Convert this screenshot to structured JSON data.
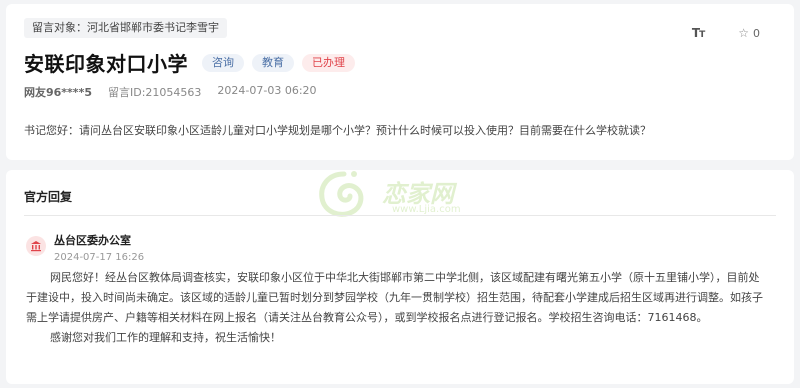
{
  "message": {
    "target_label": "留言对象：河北省邯郸市委书记李雪宇",
    "title": "安联印象对口小学",
    "badges": [
      "咨询",
      "教育",
      "已办理"
    ],
    "user": "网友96****5",
    "message_id": "留言ID:21054563",
    "datetime": "2024-07-03 06:20",
    "content": "书记您好：请问丛台区安联印象小区适龄儿童对口小学规划是哪个小学？预计什么时候可以投入使用？目前需要在什么学校就读？",
    "favorite_count": "0",
    "font_size_icon": "text-size-icon",
    "favorite_icon": "star-icon"
  },
  "reply": {
    "heading": "官方回复",
    "org_name": "丛台区委办公室",
    "org_icon": "government-building-icon",
    "time": "2024-07-17 16:26",
    "paragraph1": "网民您好！经丛台区教体局调查核实，安联印象小区位于中华北大街邯郸市第二中学北侧，该区域配建有曙光第五小学（原十五里铺小学），目前处于建设中，投入时间尚未确定。该区域的适龄儿童已暂时划分到梦园学校（九年一贯制学校）招生范围，待配套小学建成后招生区域再进行调整。如孩子需上学请提供房产、户籍等相关材料在网上报名（请关注丛台教育公众号），或到学校报名点进行登记报名。学校招生咨询电话：7161468。",
    "paragraph2": "感谢您对我们工作的理解和支持，祝生活愉快！"
  },
  "watermark": {
    "text": "恋家网",
    "sub": "www.Ljia.com"
  },
  "colors": {
    "done_red": "#e0434a",
    "badge_blue": "#4a6fa5",
    "watermark_green": "#7bbf2a"
  }
}
